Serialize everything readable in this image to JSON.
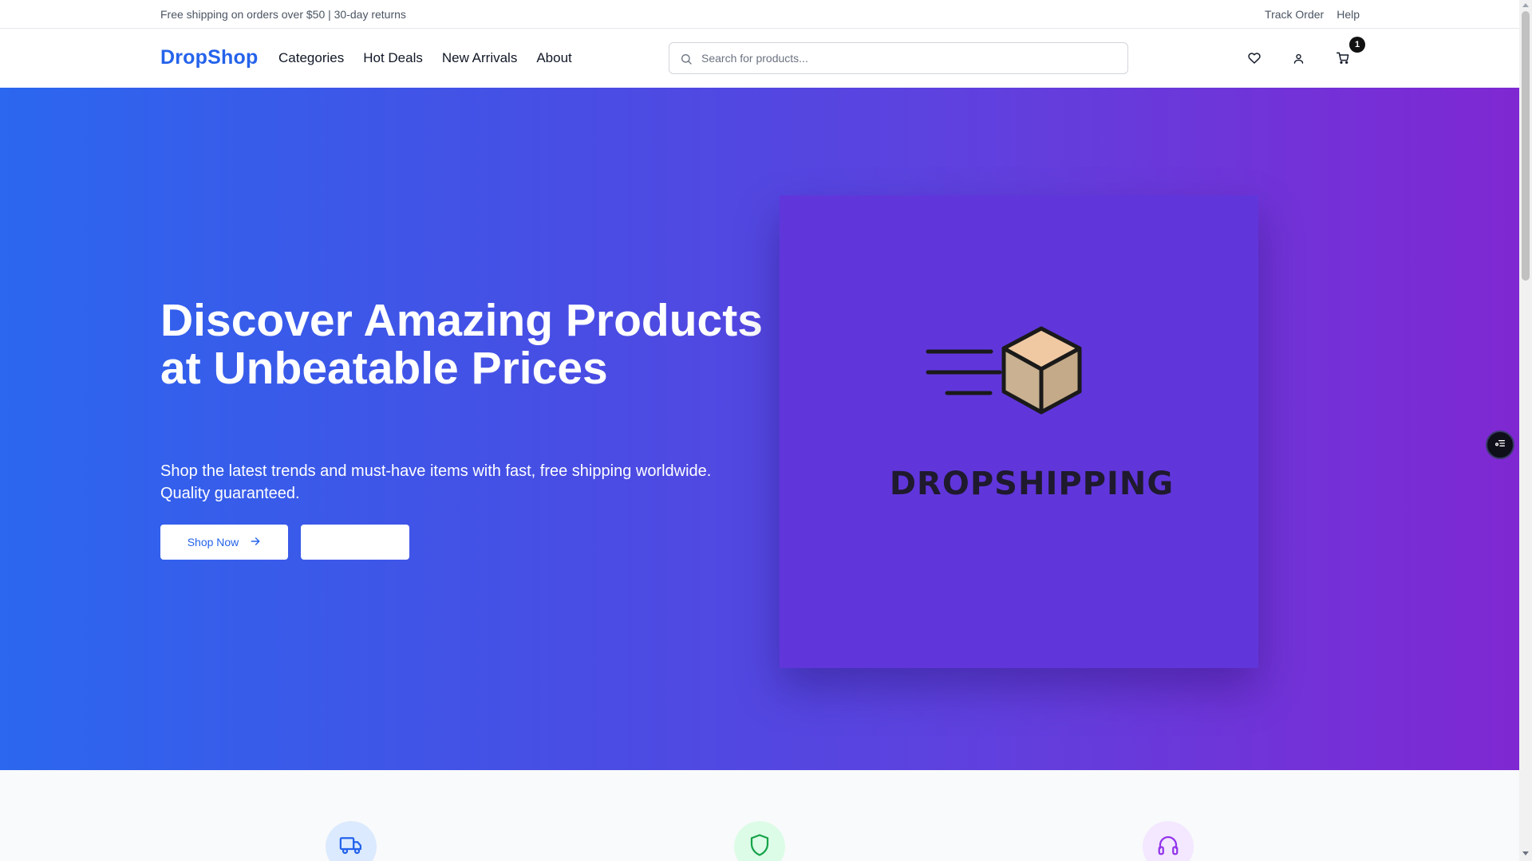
{
  "topbar": {
    "promo": "Free shipping on orders over $50 | 30-day returns",
    "links": [
      "Track Order",
      "Help"
    ]
  },
  "header": {
    "logo": "DropShop",
    "nav": [
      "Categories",
      "Hot Deals",
      "New Arrivals",
      "About"
    ],
    "search": {
      "placeholder": "Search for products...",
      "value": ""
    },
    "icons": [
      "heart-icon",
      "user-icon",
      "cart-icon"
    ],
    "cart_count": "1"
  },
  "hero": {
    "title": "Discover Amazing Products at Unbeatable Prices",
    "subtitle": "Shop the latest trends and must-have items with fast, free shipping worldwide. Quality guaranteed.",
    "primary_button": "Shop Now",
    "secondary_button": "",
    "image_text": "DROPSHIPPING"
  },
  "features": [
    {
      "icon": "truck-icon",
      "color": "#2563eb",
      "bg": "#dbeafe"
    },
    {
      "icon": "shield-icon",
      "color": "#16a34a",
      "bg": "#dcfce7"
    },
    {
      "icon": "headphones-icon",
      "color": "#9333ea",
      "bg": "#f3e8ff"
    }
  ],
  "colors": {
    "brand": "#2563eb",
    "hero_gradient_start": "#2b67ef",
    "hero_gradient_end": "#7f28d2"
  }
}
